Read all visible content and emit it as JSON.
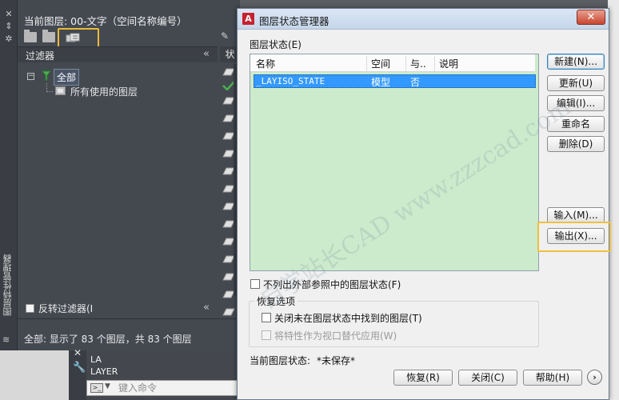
{
  "palette": {
    "vertical_title": "图层特性管理器",
    "current_layer": "当前图层: 00-文字（空间名称编号）",
    "filters_label": "过滤器",
    "status_col": "状",
    "tree": {
      "all": "全部",
      "used": "所有使用的图层"
    },
    "invert_filter": "反转过滤器(I",
    "status_text": "全部: 显示了 83 个图层，共 83 个图层",
    "collapse": "«"
  },
  "command": {
    "history": [
      "LA",
      "LAYER"
    ],
    "placeholder": "键入命令"
  },
  "dialog": {
    "logo": "A",
    "title": "图层状态管理器",
    "close": "✕",
    "layer_states_label": "图层状态(E)",
    "columns": {
      "name": "名称",
      "space": "空间",
      "same": "与..",
      "desc": "说明"
    },
    "row": {
      "name": "_LAYISO_STATE",
      "space": "模型",
      "same": "否",
      "desc": ""
    },
    "buttons": {
      "new": "新建(N)...",
      "update": "更新(U)",
      "edit": "编辑(I)...",
      "rename": "重命名",
      "delete": "删除(D)",
      "import": "输入(M)...",
      "export": "输出(X)..."
    },
    "no_xref": "不列出外部参照中的图层状态(F)",
    "restore_options": "恢复选项",
    "close_layers": "关闭未在图层状态中找到的图层(T)",
    "viewport_override": "将特性作为视口替代应用(W)",
    "current_state_label": "当前图层状态:",
    "current_state_value": "*未保存*",
    "bottom_buttons": {
      "restore": "恢复(R)",
      "close": "关闭(C)",
      "help": "帮助(H)"
    },
    "next": "›"
  },
  "watermark": "自学站长CAD  www.zzzcad.com",
  "colors": {
    "list_bg": "#ccebcc",
    "selection": "#3399ff",
    "highlight": "#e9b93a"
  }
}
